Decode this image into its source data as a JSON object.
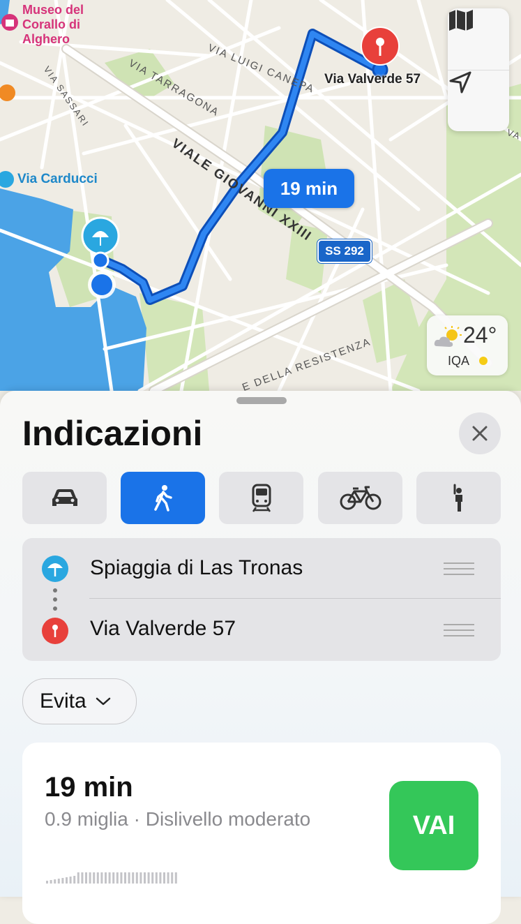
{
  "map": {
    "streets": {
      "via_luigi_canepa": "VIA LUIGI CANEPA",
      "via_tarragona": "VIA TARRAGONA",
      "via_sassari": "VIA SASSARI",
      "viale_giovanni": "VIALE GIOVANNI XXIII",
      "resistenza": "E DELLA RESISTENZA",
      "edge_va": "VA"
    },
    "poi_museum": [
      "Museo del",
      "Corallo di",
      "Alghero"
    ],
    "poi_carducci": "Via Carducci",
    "destination_label": "Via Valverde 57",
    "route_eta": "19 min",
    "road_shield": "SS 292",
    "weather": {
      "temperature": "24°",
      "aqi_label": "IQA",
      "aqi_color": "#f5cc16",
      "icon": "partly-cloudy-icon"
    },
    "controls": [
      "map-mode-icon",
      "location-arrow-icon"
    ],
    "colors": {
      "route": "#1a73e8",
      "water": "#4ba3e6",
      "park": "#cfe3b4",
      "destination": "#e8403b",
      "origin_poi": "#2aa7e0"
    }
  },
  "sheet": {
    "title": "Indicazioni",
    "close_icon": "close-icon",
    "modes": [
      {
        "name": "car-icon",
        "active": false
      },
      {
        "name": "walk-icon",
        "active": true
      },
      {
        "name": "transit-icon",
        "active": false
      },
      {
        "name": "bike-icon",
        "active": false
      },
      {
        "name": "rideshare-icon",
        "active": false
      }
    ],
    "route": {
      "origin": "Spiaggia di Las Tronas",
      "destination": "Via Valverde 57"
    },
    "avoid_label": "Evita",
    "result": {
      "time": "19 min",
      "details": "0.9 miglia · Dislivello moderato",
      "go_label": "VAI"
    }
  }
}
